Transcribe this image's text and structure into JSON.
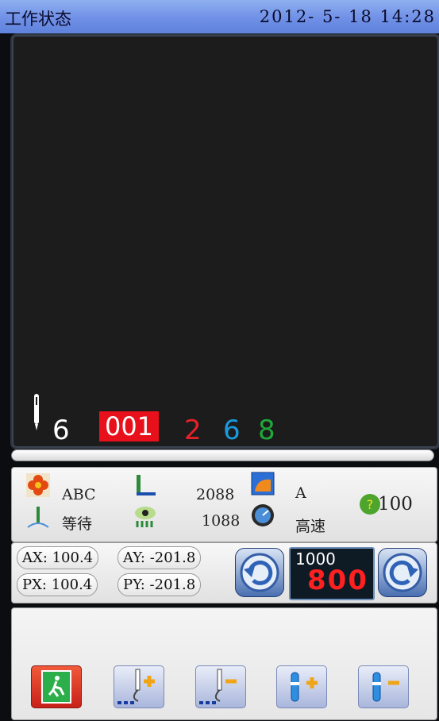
{
  "titlebar": {
    "title": "工作状态",
    "datetime": "2012- 5- 18 14:28"
  },
  "screen": {
    "stitch_count": "6",
    "design_code": "001",
    "colors": [
      {
        "value": "2",
        "color": "#e8202a"
      },
      {
        "value": "6",
        "color": "#1a9be0"
      },
      {
        "value": "8",
        "color": "#1fa83a"
      }
    ]
  },
  "status": {
    "pattern_name": "ABC",
    "state": "等待",
    "stitches_total": "2088",
    "stitches_done": "1088",
    "frame": "A",
    "speed_mode": "高速",
    "badge_value": "100"
  },
  "coords": {
    "ax": "AX: 100.4",
    "ay": "AY: -201.8",
    "px": "PX: 100.4",
    "py": "PY: -201.8"
  },
  "speed": {
    "set": "1000",
    "actual": "800"
  },
  "icons": {
    "pattern": "flower-icon",
    "state": "needle-icon",
    "stitches_total": "needle-bar-icon",
    "stitches_done": "eye-icon",
    "frame": "frame-icon",
    "speed_mode": "speedometer-icon",
    "badge": "gear-badge-icon"
  },
  "accent": {
    "title_bar": "#6f90e6",
    "highlight": "#e8101a"
  }
}
